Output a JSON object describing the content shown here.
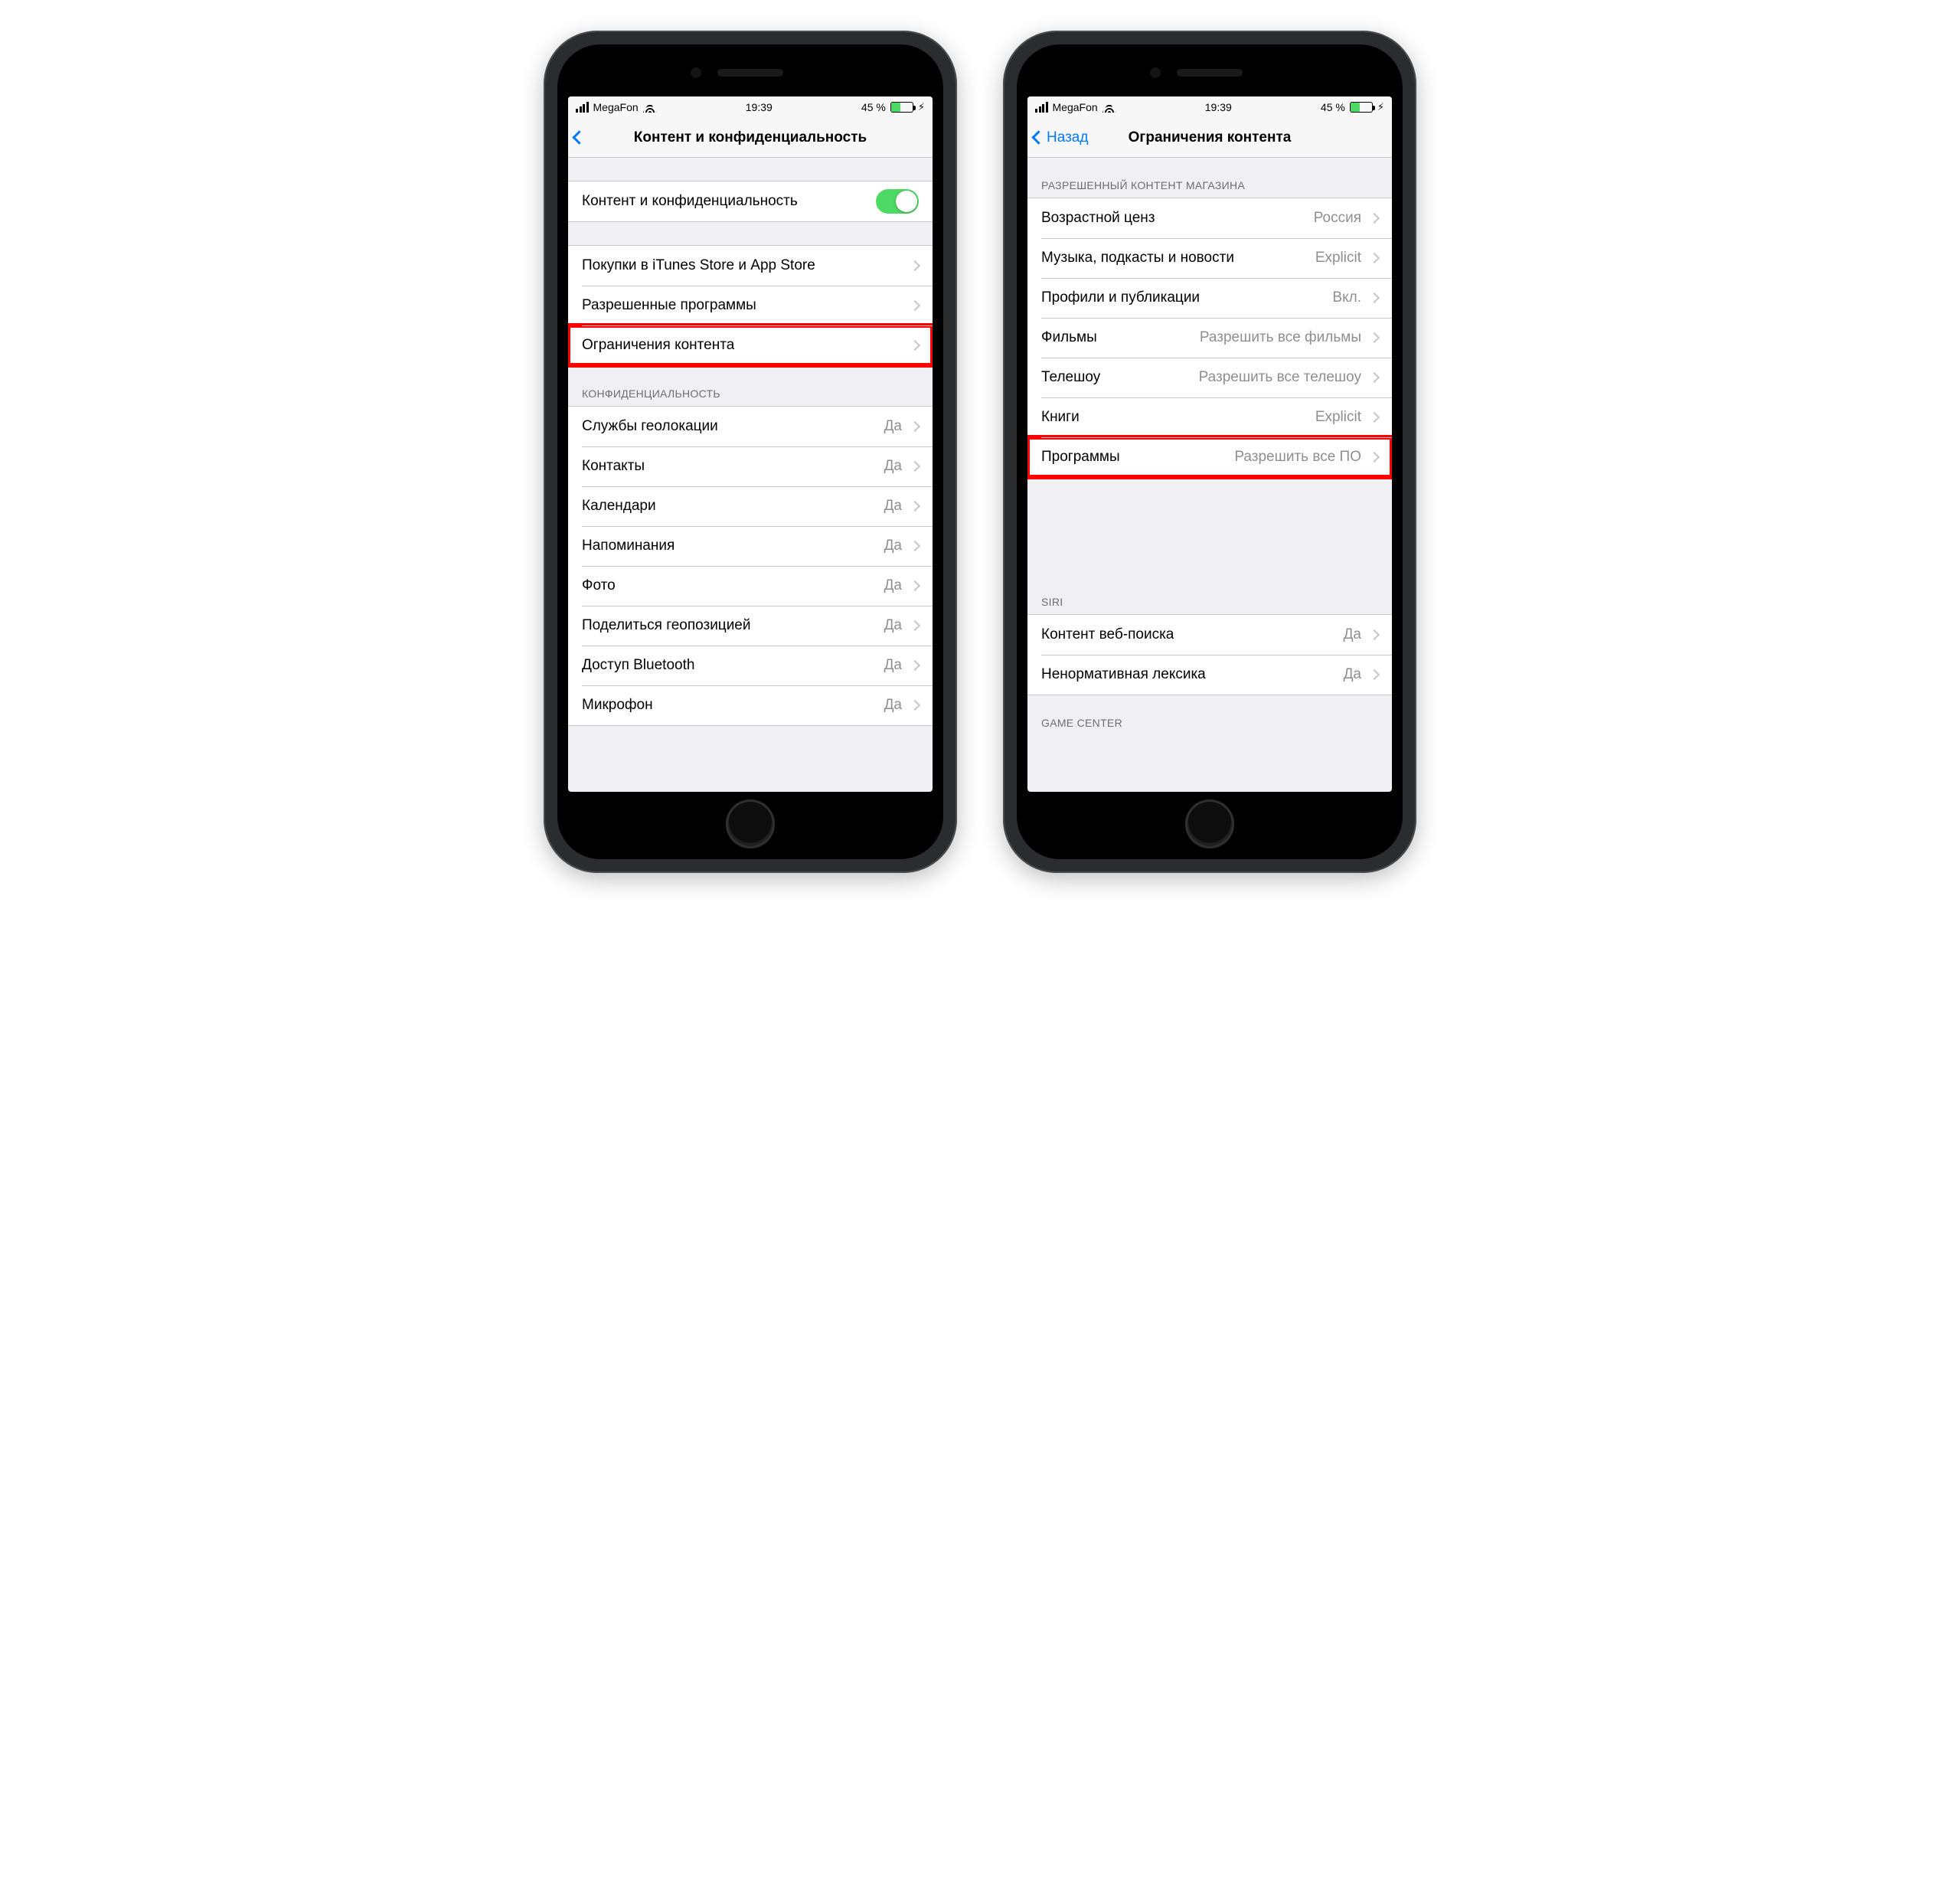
{
  "status": {
    "carrier": "MegaFon",
    "time": "19:39",
    "battery_pct": "45 %",
    "battery_fill_pct": 45
  },
  "left": {
    "nav_title": "Контент и конфиденциальность",
    "toggle_row": {
      "label": "Контент и конфиденциальность"
    },
    "group2": [
      {
        "label": "Покупки в iTunes Store и App Store"
      },
      {
        "label": "Разрешенные программы"
      },
      {
        "label": "Ограничения контента",
        "highlight": true
      }
    ],
    "section_privacy_header": "КОНФИДЕНЦИАЛЬНОСТЬ",
    "privacy_rows": [
      {
        "label": "Службы геолокации",
        "value": "Да"
      },
      {
        "label": "Контакты",
        "value": "Да"
      },
      {
        "label": "Календари",
        "value": "Да"
      },
      {
        "label": "Напоминания",
        "value": "Да"
      },
      {
        "label": "Фото",
        "value": "Да"
      },
      {
        "label": "Поделиться геопозицией",
        "value": "Да"
      },
      {
        "label": "Доступ Bluetooth",
        "value": "Да"
      },
      {
        "label": "Микрофон",
        "value": "Да"
      }
    ]
  },
  "right": {
    "nav_back": "Назад",
    "nav_title": "Ограничения контента",
    "section_store_header": "РАЗРЕШЕННЫЙ КОНТЕНТ МАГАЗИНА",
    "store_rows": [
      {
        "label": "Возрастной ценз",
        "value": "Россия"
      },
      {
        "label": "Музыка, подкасты и новости",
        "value": "Explicit"
      },
      {
        "label": "Профили и публикации",
        "value": "Вкл."
      },
      {
        "label": "Фильмы",
        "value": "Разрешить все фильмы"
      },
      {
        "label": "Телешоу",
        "value": "Разрешить все телешоу"
      },
      {
        "label": "Книги",
        "value": "Explicit"
      },
      {
        "label": "Программы",
        "value": "Разрешить все ПО",
        "highlight": true
      }
    ],
    "section_siri_header": "SIRI",
    "siri_rows": [
      {
        "label": "Контент веб-поиска",
        "value": "Да"
      },
      {
        "label": "Ненормативная лексика",
        "value": "Да"
      }
    ],
    "section_gc_header": "GAME CENTER"
  }
}
